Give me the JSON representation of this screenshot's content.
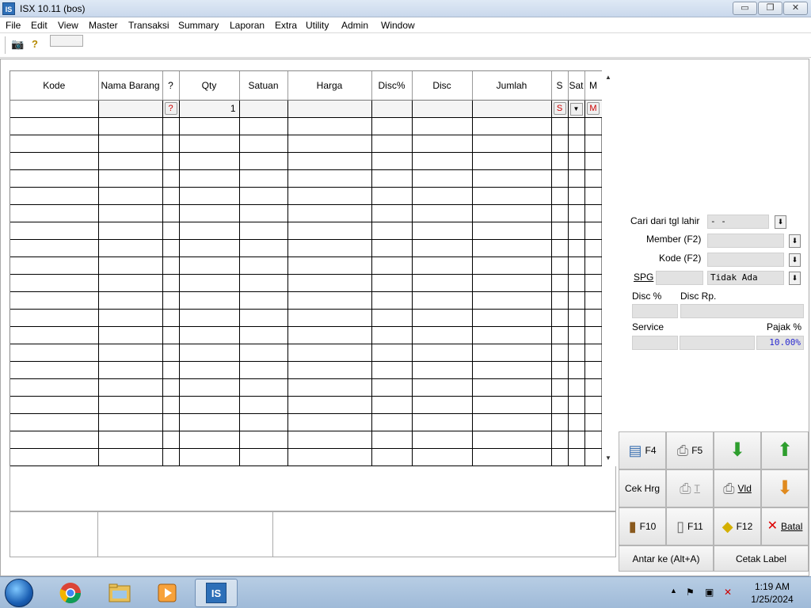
{
  "window": {
    "title": "ISX 10.11 (bos)",
    "app_icon_text": "IS",
    "min_glyph": "▭",
    "max_glyph": "❐",
    "close_glyph": "✕"
  },
  "menu": [
    "File",
    "Edit",
    "View",
    "Master",
    "Transaksi",
    "Summary",
    "Laporan",
    "Extra",
    "Utility",
    "Admin",
    "Window"
  ],
  "toolbar": {
    "camera_glyph": "📷",
    "help_glyph": "?"
  },
  "grid": {
    "columns": [
      "Kode",
      "Nama Barang",
      "?",
      "Qty",
      "Satuan",
      "Harga",
      "Disc%",
      "Disc",
      "Jumlah",
      "S",
      "Sat",
      "M"
    ],
    "input_row": {
      "qmark": "?",
      "qty": "1",
      "s_btn": "S",
      "sat_btn": "▼",
      "m_btn": "M"
    },
    "scroll_up": "▲",
    "scroll_down": "▼"
  },
  "side": {
    "cari_label": "Cari dari tgl lahir",
    "cari_value": "-  -",
    "member_label": "Member (F2)",
    "kode_label": "Kode (F2)",
    "spg_label": "SPG",
    "spg_value": "Tidak Ada",
    "disc_pct_label": "Disc %",
    "disc_rp_label": "Disc Rp.",
    "service_label": "Service",
    "pajak_label": "Pajak %",
    "pajak_value": "10.00%",
    "dropdown_glyph": "⬇"
  },
  "actions": {
    "f4": "F4",
    "f5": "F5",
    "cek_hrg": "Cek Hrg",
    "t": "T",
    "vld": "Vld",
    "f10": "F10",
    "f11": "F11",
    "f12": "F12",
    "batal": "Batal",
    "antar": "Antar ke (Alt+A)",
    "cetak": "Cetak Label"
  },
  "taskbar": {
    "time": "1:19 AM",
    "date": "1/25/2024",
    "isx_label": "IS"
  }
}
